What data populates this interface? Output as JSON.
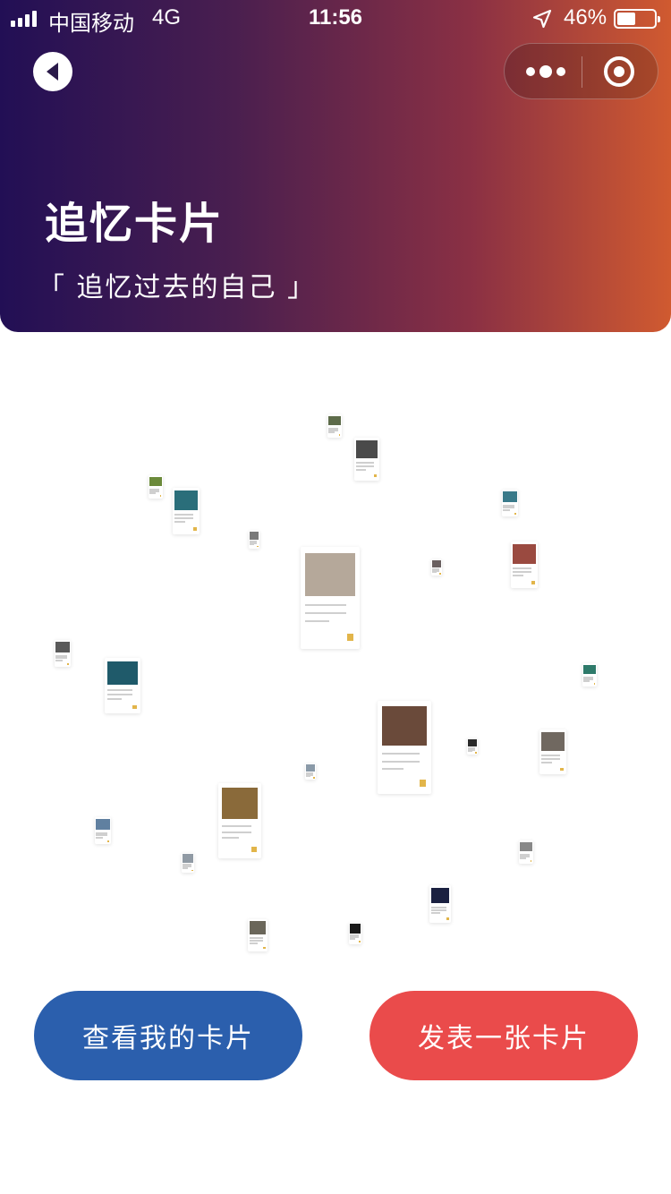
{
  "status_bar": {
    "carrier": "中国移动",
    "network": "4G",
    "time": "11:56",
    "battery_percent": "46%",
    "icons": [
      "signal-icon",
      "location-icon",
      "battery-icon"
    ]
  },
  "nav": {
    "back_icon": "back-arrow-icon",
    "more_icon": "more-dots-icon",
    "close_icon": "target-circle-icon"
  },
  "header": {
    "title": "追忆卡片",
    "subtitle": "「 追忆过去的自己 」",
    "gradient_colors": [
      "#220f55",
      "#8a3044",
      "#d05a30"
    ]
  },
  "cards": [
    {
      "photo_color": "#5d6b4a"
    },
    {
      "photo_color": "#4a4a4a"
    },
    {
      "photo_color": "#6b8a3a"
    },
    {
      "photo_color": "#2a6e7a"
    },
    {
      "photo_color": "#3a7a8a"
    },
    {
      "photo_color": "#7a7a7a"
    },
    {
      "photo_color": "#b5a89a"
    },
    {
      "photo_color": "#6a6060"
    },
    {
      "photo_color": "#9a4a40"
    },
    {
      "photo_color": "#5a5a5a"
    },
    {
      "photo_color": "#1f5a6a"
    },
    {
      "photo_color": "#2e7a6a"
    },
    {
      "photo_color": "#6a4a3a"
    },
    {
      "photo_color": "#2a2a2a"
    },
    {
      "photo_color": "#706860"
    },
    {
      "photo_color": "#8a9aa8"
    },
    {
      "photo_color": "#8a6a3a"
    },
    {
      "photo_color": "#6080a0"
    },
    {
      "photo_color": "#909aa4"
    },
    {
      "photo_color": "#888888"
    },
    {
      "photo_color": "#1a2040"
    },
    {
      "photo_color": "#6a665a"
    },
    {
      "photo_color": "#1a1a1a"
    }
  ],
  "buttons": {
    "view_label": "查看我的卡片",
    "post_label": "发表一张卡片",
    "view_color": "#2b5fad",
    "post_color": "#ea4b4b"
  }
}
